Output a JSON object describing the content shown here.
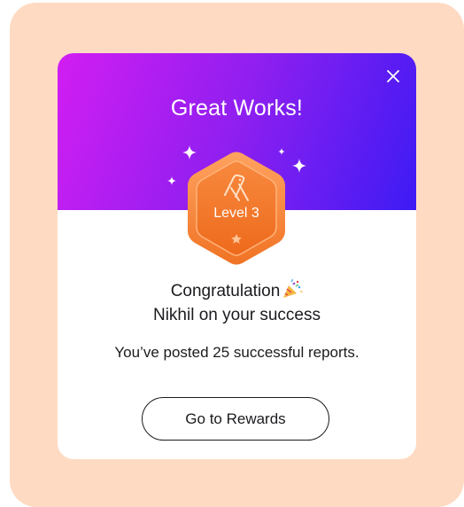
{
  "modal": {
    "title": "Great Works!",
    "badge": {
      "level_label": "Level 3",
      "icon": "abstract-logo-icon"
    },
    "headline_line1": "Congratulation",
    "headline_line2": "Nikhil on your success",
    "message": "You’ve posted 25 successful reports.",
    "cta_label": "Go to Rewards",
    "close_icon": "close-icon",
    "celebration_icon": "party-popper-icon"
  },
  "colors": {
    "backdrop": "#FFDAC3",
    "gradient_start": "#D21DF2",
    "gradient_end": "#3D1BF4",
    "badge_orange": "#F68A3A",
    "text_dark": "#1B1B1F"
  }
}
